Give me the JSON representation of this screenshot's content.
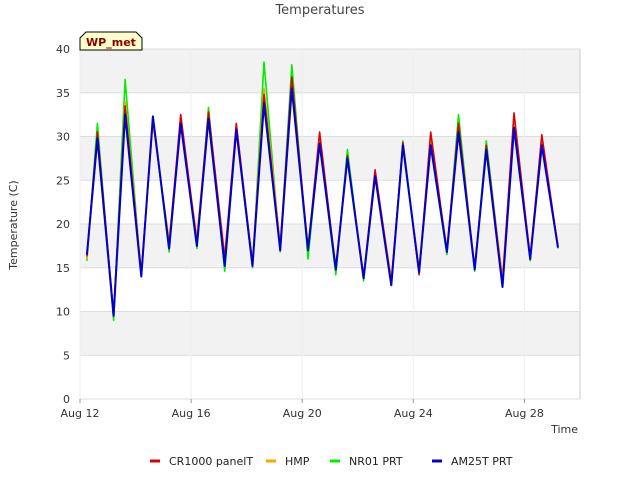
{
  "chart_data": {
    "type": "line",
    "title": "Temperatures",
    "xlabel": "Time",
    "ylabel": "Temperature (C)",
    "station_badge": "WP_met",
    "ylim": [
      0,
      40
    ],
    "yticks": [
      0,
      5,
      10,
      15,
      20,
      25,
      30,
      35,
      40
    ],
    "xlim": [
      "2023-08-12",
      "2023-08-30"
    ],
    "xticks": [
      {
        "date": "2023-08-12",
        "label": "Aug 12"
      },
      {
        "date": "2023-08-16",
        "label": "Aug 16"
      },
      {
        "date": "2023-08-20",
        "label": "Aug 20"
      },
      {
        "date": "2023-08-24",
        "label": "Aug 24"
      },
      {
        "date": "2023-08-28",
        "label": "Aug 28"
      }
    ],
    "grid": true,
    "legend_position": "bottom",
    "series": [
      {
        "name": "CR1000 panelT",
        "color": "#dd0000",
        "points": [
          [
            "2023-08-12 06:00",
            16.3
          ],
          [
            "2023-08-12 15:00",
            30.5
          ],
          [
            "2023-08-13 05:00",
            9.8
          ],
          [
            "2023-08-13 15:00",
            33.5
          ],
          [
            "2023-08-14 05:00",
            14.3
          ],
          [
            "2023-08-14 15:00",
            32.0
          ],
          [
            "2023-08-15 05:00",
            17.5
          ],
          [
            "2023-08-15 15:00",
            32.5
          ],
          [
            "2023-08-16 05:00",
            17.8
          ],
          [
            "2023-08-16 15:00",
            32.8
          ],
          [
            "2023-08-17 05:00",
            16.0
          ],
          [
            "2023-08-17 15:00",
            31.5
          ],
          [
            "2023-08-18 05:00",
            15.3
          ],
          [
            "2023-08-18 15:00",
            34.8
          ],
          [
            "2023-08-19 05:00",
            17.2
          ],
          [
            "2023-08-19 15:00",
            36.8
          ],
          [
            "2023-08-20 05:00",
            17.0
          ],
          [
            "2023-08-20 15:00",
            30.5
          ],
          [
            "2023-08-21 05:00",
            14.8
          ],
          [
            "2023-08-21 15:00",
            27.8
          ],
          [
            "2023-08-22 05:00",
            13.8
          ],
          [
            "2023-08-22 15:00",
            26.2
          ],
          [
            "2023-08-23 05:00",
            13.2
          ],
          [
            "2023-08-23 15:00",
            29.3
          ],
          [
            "2023-08-24 05:00",
            14.2
          ],
          [
            "2023-08-24 15:00",
            30.5
          ],
          [
            "2023-08-25 05:00",
            16.8
          ],
          [
            "2023-08-25 15:00",
            31.5
          ],
          [
            "2023-08-26 05:00",
            14.8
          ],
          [
            "2023-08-26 15:00",
            29.0
          ],
          [
            "2023-08-27 05:00",
            13.2
          ],
          [
            "2023-08-27 15:00",
            32.7
          ],
          [
            "2023-08-28 05:00",
            16.0
          ],
          [
            "2023-08-28 15:00",
            30.2
          ],
          [
            "2023-08-29 05:00",
            17.3
          ]
        ]
      },
      {
        "name": "HMP",
        "color": "#ffa500",
        "points": [
          [
            "2023-08-12 06:00",
            16.0
          ],
          [
            "2023-08-12 15:00",
            29.5
          ],
          [
            "2023-08-13 05:00",
            9.5
          ],
          [
            "2023-08-13 15:00",
            34.0
          ],
          [
            "2023-08-14 05:00",
            14.5
          ],
          [
            "2023-08-14 15:00",
            31.5
          ],
          [
            "2023-08-15 05:00",
            18.2
          ],
          [
            "2023-08-15 15:00",
            31.8
          ],
          [
            "2023-08-16 05:00",
            18.5
          ],
          [
            "2023-08-16 15:00",
            32.5
          ],
          [
            "2023-08-17 05:00",
            16.5
          ],
          [
            "2023-08-17 15:00",
            30.5
          ],
          [
            "2023-08-18 05:00",
            15.8
          ],
          [
            "2023-08-18 15:00",
            35.5
          ],
          [
            "2023-08-19 05:00",
            17.8
          ],
          [
            "2023-08-19 15:00",
            36.0
          ],
          [
            "2023-08-20 05:00",
            17.5
          ],
          [
            "2023-08-20 15:00",
            29.8
          ],
          [
            "2023-08-21 05:00",
            15.2
          ],
          [
            "2023-08-21 15:00",
            27.5
          ],
          [
            "2023-08-22 05:00",
            14.2
          ],
          [
            "2023-08-22 15:00",
            25.8
          ],
          [
            "2023-08-23 05:00",
            13.8
          ],
          [
            "2023-08-23 15:00",
            28.8
          ],
          [
            "2023-08-24 05:00",
            15.0
          ],
          [
            "2023-08-24 15:00",
            29.5
          ],
          [
            "2023-08-25 05:00",
            17.2
          ],
          [
            "2023-08-25 15:00",
            31.0
          ],
          [
            "2023-08-26 05:00",
            15.2
          ],
          [
            "2023-08-26 15:00",
            28.5
          ],
          [
            "2023-08-27 05:00",
            14.0
          ],
          [
            "2023-08-27 15:00",
            31.8
          ],
          [
            "2023-08-28 05:00",
            16.5
          ],
          [
            "2023-08-28 15:00",
            29.5
          ],
          [
            "2023-08-29 05:00",
            17.6
          ]
        ]
      },
      {
        "name": "NR01 PRT",
        "color": "#00ee00",
        "points": [
          [
            "2023-08-12 06:00",
            15.8
          ],
          [
            "2023-08-12 15:00",
            31.5
          ],
          [
            "2023-08-13 05:00",
            9.0
          ],
          [
            "2023-08-13 15:00",
            36.5
          ],
          [
            "2023-08-14 05:00",
            14.0
          ],
          [
            "2023-08-14 15:00",
            32.3
          ],
          [
            "2023-08-15 05:00",
            16.8
          ],
          [
            "2023-08-15 15:00",
            32.0
          ],
          [
            "2023-08-16 05:00",
            17.2
          ],
          [
            "2023-08-16 15:00",
            33.3
          ],
          [
            "2023-08-17 05:00",
            14.6
          ],
          [
            "2023-08-17 15:00",
            30.8
          ],
          [
            "2023-08-18 05:00",
            15.0
          ],
          [
            "2023-08-18 15:00",
            38.5
          ],
          [
            "2023-08-19 05:00",
            16.8
          ],
          [
            "2023-08-19 15:00",
            38.2
          ],
          [
            "2023-08-20 05:00",
            16.0
          ],
          [
            "2023-08-20 15:00",
            29.5
          ],
          [
            "2023-08-21 05:00",
            14.2
          ],
          [
            "2023-08-21 15:00",
            28.5
          ],
          [
            "2023-08-22 05:00",
            13.5
          ],
          [
            "2023-08-22 15:00",
            25.5
          ],
          [
            "2023-08-23 05:00",
            13.0
          ],
          [
            "2023-08-23 15:00",
            29.5
          ],
          [
            "2023-08-24 05:00",
            14.5
          ],
          [
            "2023-08-24 15:00",
            29.0
          ],
          [
            "2023-08-25 05:00",
            16.5
          ],
          [
            "2023-08-25 15:00",
            32.5
          ],
          [
            "2023-08-26 05:00",
            14.6
          ],
          [
            "2023-08-26 15:00",
            29.5
          ],
          [
            "2023-08-27 05:00",
            13.5
          ],
          [
            "2023-08-27 15:00",
            32.3
          ],
          [
            "2023-08-28 05:00",
            15.8
          ],
          [
            "2023-08-28 15:00",
            29.8
          ],
          [
            "2023-08-29 05:00",
            17.2
          ]
        ]
      },
      {
        "name": "AM25T PRT",
        "color": "#0000cc",
        "points": [
          [
            "2023-08-12 06:00",
            16.5
          ],
          [
            "2023-08-12 15:00",
            29.8
          ],
          [
            "2023-08-13 05:00",
            9.5
          ],
          [
            "2023-08-13 15:00",
            32.5
          ],
          [
            "2023-08-14 05:00",
            14.0
          ],
          [
            "2023-08-14 15:00",
            32.3
          ],
          [
            "2023-08-15 05:00",
            17.2
          ],
          [
            "2023-08-15 15:00",
            31.5
          ],
          [
            "2023-08-16 05:00",
            17.5
          ],
          [
            "2023-08-16 15:00",
            32.0
          ],
          [
            "2023-08-17 05:00",
            15.2
          ],
          [
            "2023-08-17 15:00",
            30.8
          ],
          [
            "2023-08-18 05:00",
            15.2
          ],
          [
            "2023-08-18 15:00",
            33.8
          ],
          [
            "2023-08-19 05:00",
            17.0
          ],
          [
            "2023-08-19 15:00",
            35.5
          ],
          [
            "2023-08-20 05:00",
            17.0
          ],
          [
            "2023-08-20 15:00",
            29.2
          ],
          [
            "2023-08-21 05:00",
            14.8
          ],
          [
            "2023-08-21 15:00",
            27.5
          ],
          [
            "2023-08-22 05:00",
            13.8
          ],
          [
            "2023-08-22 15:00",
            25.5
          ],
          [
            "2023-08-23 05:00",
            13.0
          ],
          [
            "2023-08-23 15:00",
            29.0
          ],
          [
            "2023-08-24 05:00",
            14.5
          ],
          [
            "2023-08-24 15:00",
            29.0
          ],
          [
            "2023-08-25 05:00",
            16.8
          ],
          [
            "2023-08-25 15:00",
            30.5
          ],
          [
            "2023-08-26 05:00",
            14.8
          ],
          [
            "2023-08-26 15:00",
            28.5
          ],
          [
            "2023-08-27 05:00",
            12.8
          ],
          [
            "2023-08-27 15:00",
            31.0
          ],
          [
            "2023-08-28 05:00",
            16.0
          ],
          [
            "2023-08-28 15:00",
            29.0
          ],
          [
            "2023-08-29 05:00",
            17.3
          ]
        ]
      }
    ]
  }
}
